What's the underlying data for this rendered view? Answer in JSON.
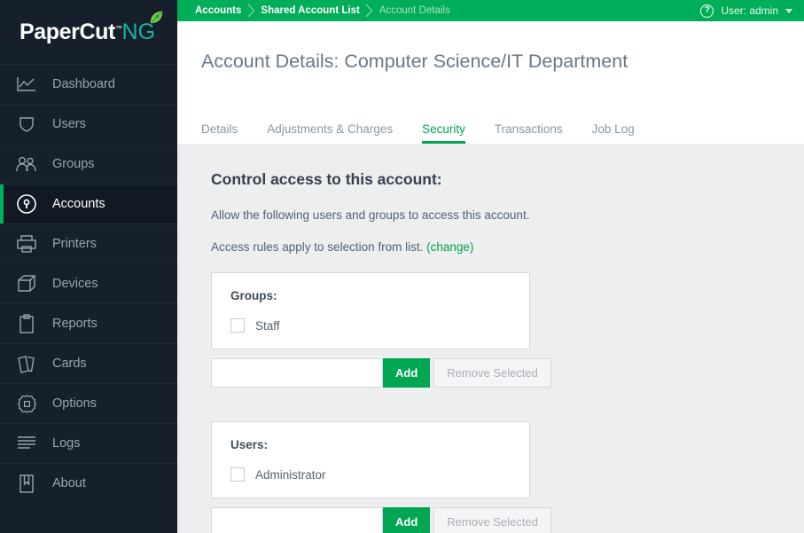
{
  "brand": {
    "name_primary": "PaperCut",
    "name_suffix": "NG",
    "trademark": "™",
    "leaf_icon": "leaf-icon",
    "accent_green": "#00a651",
    "sidebar_bg": "#16202c",
    "header_green": "#00ad58"
  },
  "sidebar": {
    "items": [
      {
        "label": "Dashboard",
        "icon": "chart-line-icon",
        "active": false
      },
      {
        "label": "Users",
        "icon": "user-shield-icon",
        "active": false
      },
      {
        "label": "Groups",
        "icon": "group-people-icon",
        "active": false
      },
      {
        "label": "Accounts",
        "icon": "account-lock-circle-icon",
        "active": true
      },
      {
        "label": "Printers",
        "icon": "printer-icon",
        "active": false
      },
      {
        "label": "Devices",
        "icon": "device-icon",
        "active": false
      },
      {
        "label": "Reports",
        "icon": "clipboard-icon",
        "active": false
      },
      {
        "label": "Cards",
        "icon": "cards-icon",
        "active": false
      },
      {
        "label": "Options",
        "icon": "gear-icon",
        "active": false
      },
      {
        "label": "Logs",
        "icon": "lines-log-icon",
        "active": false
      },
      {
        "label": "About",
        "icon": "book-bookmark-icon",
        "active": false
      }
    ]
  },
  "topbar": {
    "breadcrumbs": [
      {
        "label": "Accounts",
        "current": false
      },
      {
        "label": "Shared Account List",
        "current": false
      },
      {
        "label": "Account Details",
        "current": true
      }
    ],
    "help_icon": "help-question-icon",
    "user_label": "User: admin",
    "caret_icon": "chevron-down-icon"
  },
  "page": {
    "title": "Account Details: Computer Science/IT Department",
    "tabs": [
      {
        "label": "Details",
        "active": false
      },
      {
        "label": "Adjustments & Charges",
        "active": false
      },
      {
        "label": "Security",
        "active": true
      },
      {
        "label": "Transactions",
        "active": false
      },
      {
        "label": "Job Log",
        "active": false
      }
    ]
  },
  "security": {
    "heading": "Control access to this account:",
    "description": "Allow the following users and groups to access this account.",
    "rule_text": "Access rules apply to selection from list.",
    "change_link": "(change)",
    "groups": {
      "label": "Groups:",
      "entries": [
        {
          "name": "Staff",
          "checked": false
        }
      ],
      "input_value": "",
      "input_placeholder": "",
      "add_label": "Add",
      "remove_label": "Remove Selected",
      "remove_disabled": true
    },
    "users": {
      "label": "Users:",
      "entries": [
        {
          "name": "Administrator",
          "checked": false
        }
      ],
      "input_value": "",
      "input_placeholder": "",
      "add_label": "Add",
      "remove_label": "Remove Selected",
      "remove_disabled": true
    }
  }
}
